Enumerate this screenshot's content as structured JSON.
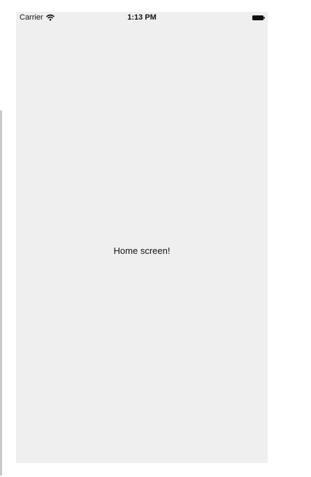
{
  "status_bar": {
    "carrier": "Carrier",
    "time": "1:13 PM",
    "wifi_icon": "wifi-icon",
    "battery_icon": "battery-full-icon"
  },
  "main": {
    "message": "Home screen!"
  },
  "colors": {
    "screen_background": "#efefef",
    "text": "#111111"
  }
}
